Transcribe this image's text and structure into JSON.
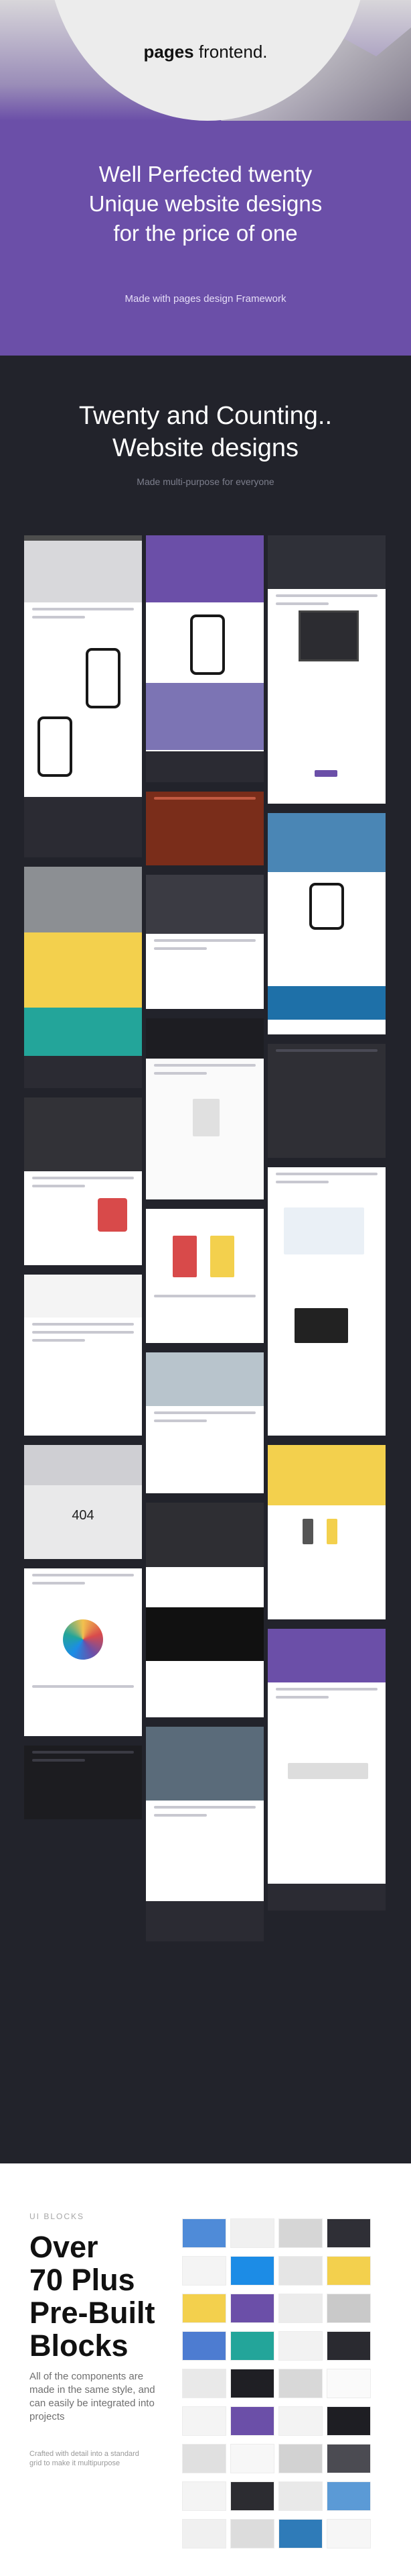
{
  "hero": {
    "logo_main": "pages",
    "logo_sub": "frontend.",
    "heading_lines": [
      "Well Perfected twenty",
      "Unique website designs",
      "for the price of one"
    ],
    "subtitle": "Made with pages design Framework"
  },
  "showcase": {
    "title_lines": [
      "Twenty and Counting..",
      "Website designs"
    ],
    "subtitle": "Made multi-purpose for everyone",
    "card_labels": [
      "404"
    ]
  },
  "blocks": {
    "label": "UI BLOCKS",
    "title_lines": [
      "Over",
      "70 Plus",
      "Pre-Built",
      "Blocks"
    ],
    "description": "All of the components are made in the same style, and can easily be integrated into projects",
    "small_note": "Crafted with detail into a standard grid to make it multipurpose"
  },
  "colors": {
    "hero_purple": "#6b4fa8",
    "dark_bg": "#22232b",
    "accent_blue": "#1c8ce6",
    "accent_yellow": "#f3d04d",
    "accent_teal": "#23a59a"
  }
}
